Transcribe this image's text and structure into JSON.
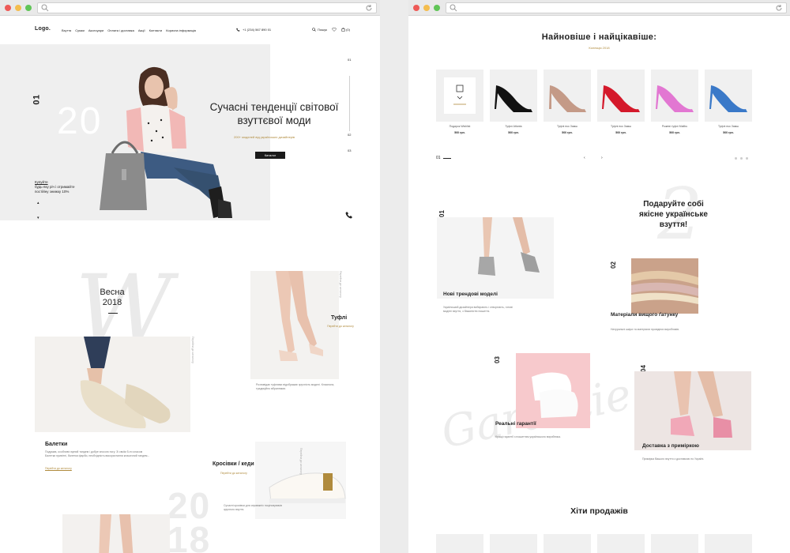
{
  "header": {
    "logo": "Logo.",
    "nav": [
      "Взуття",
      "Сумки",
      "Аксесуари",
      "Оплата і доставка",
      "Акції",
      "Контакти",
      "Корисна інформація"
    ],
    "phone": "+1 (234) 567 890 01",
    "search": "Пошук",
    "cart_count": "(0)"
  },
  "hero": {
    "side_num": "01",
    "bg_num": "20",
    "title": "Сучасні тенденції світової взуттєвої моди",
    "subtitle": "200+ моделей від українських дизайнерів",
    "button": "Каталог",
    "promo_link": "Купуйте",
    "promo_text": "будь-яку річ і отримайте постійну знижку 10%",
    "slider": [
      "01",
      "02",
      "03"
    ]
  },
  "spring": {
    "title": "Весна\n2018",
    "script_letter": "W",
    "big_year": "20\n18",
    "cats": [
      {
        "title": "Балетки",
        "sub": "Перейти до каталогу",
        "text": "Подумав, особливі гарний тандем і добре зносою ногу. Зі своїм 5-ти класом Балетки привітні, балетки фарби, необхідність використання класичний тандем..."
      },
      {
        "title": "Туфлі",
        "sub": "Перейти до каталогу",
        "text": "Розповідає туфлями відображає зручність моделі. Класична, традиційно вбраннями."
      },
      {
        "title": "Кросівки / кеди",
        "sub": "Перейти до каталогу",
        "text": "Сучасні кросівки для справжніх поціновувачів зручного взуття."
      }
    ]
  },
  "newest": {
    "title": "Найновіше і найцікавіше:",
    "subtitle": "Колекція 2018",
    "products": [
      {
        "name": "Подарок Wishlist",
        "price": "500 грн.",
        "color": "#ffffff"
      },
      {
        "name": "Туфлі Atlanta",
        "price": "500 грн.",
        "color": "#111111"
      },
      {
        "name": "Туфлі еко Замш",
        "price": "500 грн.",
        "color": "#c49a87"
      },
      {
        "name": "Туфлі еко Замш",
        "price": "500 грн.",
        "color": "#d4192b"
      },
      {
        "name": "Рожеві туфлі Malibu",
        "price": "500 грн.",
        "color": "#e277d2"
      },
      {
        "name": "Туфлі еко Замш",
        "price": "500 грн.",
        "color": "#3a79c8"
      }
    ],
    "pager_num": "01"
  },
  "features": {
    "gift": "Подаруйте собі якісне українське взуття!",
    "items": [
      {
        "num": "01",
        "title": "Нові трендові моделі",
        "text": "Український дизайнери вибирають і створюють, готові моделі взуття, з бажаністю пошиття."
      },
      {
        "num": "02",
        "title": "Матеріали вищого ґатунку",
        "text": "Натуральні шкіри та матеріали провідних виробників."
      },
      {
        "num": "03",
        "title": "Реальні гарантії",
        "text": "Кращі гарантії з пошиттям українського виробника."
      },
      {
        "num": "04",
        "title": "Доставка з приміркою",
        "text": "Примірка Вашого взуття з доставкою по Україні."
      }
    ]
  },
  "hits": {
    "title": "Хіти продажів"
  },
  "colors": {
    "accent": "#b08b3d",
    "dark": "#1a1a1a"
  }
}
